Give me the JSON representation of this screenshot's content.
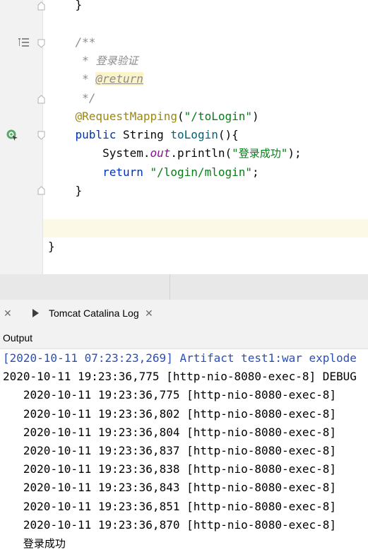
{
  "editor": {
    "lines": [
      {
        "id": "l0",
        "indent": "    ",
        "parts": [
          {
            "t": "}",
            "c": ""
          }
        ]
      },
      {
        "id": "l1",
        "indent": "",
        "parts": []
      },
      {
        "id": "l2",
        "indent": "    ",
        "parts": [
          {
            "t": "/**",
            "c": "c-doc"
          }
        ]
      },
      {
        "id": "l3",
        "indent": "     ",
        "parts": [
          {
            "t": "* ",
            "c": "c-doc"
          },
          {
            "t": "登录验证",
            "c": "c-doc c-doc-cn"
          }
        ]
      },
      {
        "id": "l4",
        "indent": "     ",
        "parts": [
          {
            "t": "* ",
            "c": "c-doc"
          },
          {
            "t": "@return",
            "c": "c-doctag"
          }
        ]
      },
      {
        "id": "l5",
        "indent": "     ",
        "parts": [
          {
            "t": "*/",
            "c": "c-doc"
          }
        ]
      },
      {
        "id": "l6",
        "indent": "    ",
        "parts": [
          {
            "t": "@RequestMapping",
            "c": "c-anno"
          },
          {
            "t": "(",
            "c": ""
          },
          {
            "t": "\"/toLogin\"",
            "c": "c-str"
          },
          {
            "t": ")",
            "c": ""
          }
        ]
      },
      {
        "id": "l7",
        "indent": "    ",
        "parts": [
          {
            "t": "public ",
            "c": "c-kw"
          },
          {
            "t": "String ",
            "c": ""
          },
          {
            "t": "toLogin",
            "c": "c-fn"
          },
          {
            "t": "(){",
            "c": ""
          }
        ]
      },
      {
        "id": "l8",
        "indent": "        ",
        "parts": [
          {
            "t": "System.",
            "c": ""
          },
          {
            "t": "out",
            "c": "c-static"
          },
          {
            "t": ".println(",
            "c": ""
          },
          {
            "t": "\"",
            "c": "c-str"
          },
          {
            "t": "登录成功",
            "c": "c-str c-str-cn"
          },
          {
            "t": "\"",
            "c": "c-str"
          },
          {
            "t": ");",
            "c": ""
          }
        ]
      },
      {
        "id": "l9",
        "indent": "        ",
        "parts": [
          {
            "t": "return ",
            "c": "c-kw"
          },
          {
            "t": "\"/login/mlogin\"",
            "c": "c-str"
          },
          {
            "t": ";",
            "c": ""
          }
        ]
      },
      {
        "id": "l10",
        "indent": "    ",
        "parts": [
          {
            "t": "}",
            "c": ""
          }
        ]
      },
      {
        "id": "l11",
        "indent": "",
        "parts": []
      },
      {
        "id": "l12",
        "indent": "",
        "parts": []
      },
      {
        "id": "l13",
        "indent": "",
        "parts": [
          {
            "t": "}",
            "c": ""
          }
        ]
      }
    ]
  },
  "toolwindow": {
    "tab_label": "Tomcat Catalina Log",
    "close_glyph": "✕",
    "output_label": "Output"
  },
  "console": {
    "lines": [
      {
        "text": "[2020-10-11 07:23:23,269] Artifact test1:war explode",
        "style": "blue",
        "indent": ""
      },
      {
        "text": "2020-10-11 19:23:36,775 [http-nio-8080-exec-8] DEBUG",
        "style": "",
        "indent": ""
      },
      {
        "text": "2020-10-11 19:23:36,775 [http-nio-8080-exec-8]",
        "style": "",
        "indent": "   "
      },
      {
        "text": "2020-10-11 19:23:36,802 [http-nio-8080-exec-8]",
        "style": "",
        "indent": "   "
      },
      {
        "text": "2020-10-11 19:23:36,804 [http-nio-8080-exec-8]",
        "style": "",
        "indent": "   "
      },
      {
        "text": "2020-10-11 19:23:36,837 [http-nio-8080-exec-8]",
        "style": "",
        "indent": "   "
      },
      {
        "text": "2020-10-11 19:23:36,838 [http-nio-8080-exec-8]",
        "style": "",
        "indent": "   "
      },
      {
        "text": "2020-10-11 19:23:36,843 [http-nio-8080-exec-8]",
        "style": "",
        "indent": "   "
      },
      {
        "text": "2020-10-11 19:23:36,851 [http-nio-8080-exec-8]",
        "style": "",
        "indent": "   "
      },
      {
        "text": "2020-10-11 19:23:36,870 [http-nio-8080-exec-8]",
        "style": "",
        "indent": "   "
      },
      {
        "text": "登录成功",
        "style": "cn",
        "indent": "   "
      }
    ]
  },
  "icons": {
    "structure": "structure-icon",
    "run_gutter": "request-mapping-gutter-icon",
    "tab": "tomcat-log-icon"
  }
}
